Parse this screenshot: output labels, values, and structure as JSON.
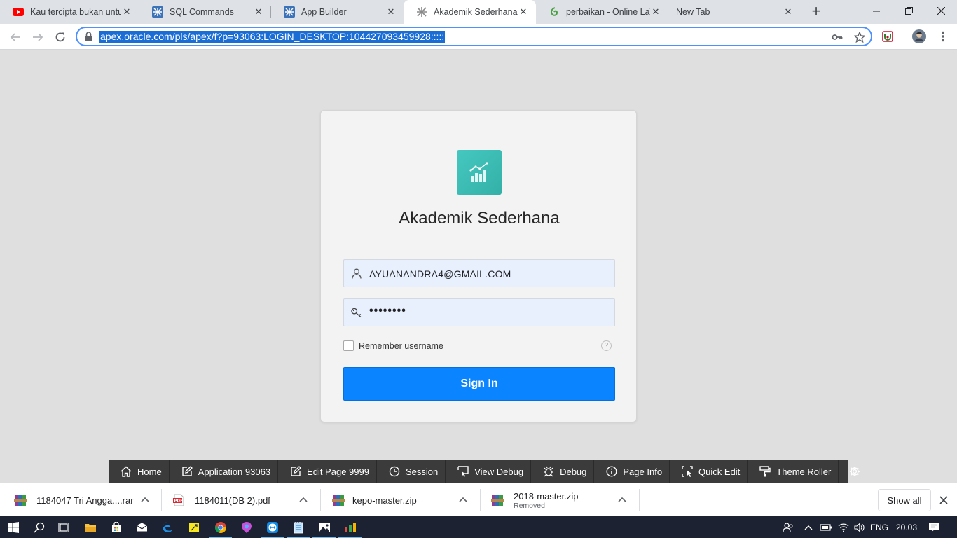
{
  "browser": {
    "tabs": [
      {
        "label": "Kau tercipta bukan untuk",
        "icon": "youtube-icon",
        "active": false
      },
      {
        "label": "SQL Commands",
        "icon": "apex-icon",
        "active": false
      },
      {
        "label": "App Builder",
        "icon": "apex-icon",
        "active": false
      },
      {
        "label": "Akademik Sederhana - ",
        "icon": "apex-icon",
        "active": true
      },
      {
        "label": "perbaikan - Online LaTeX",
        "icon": "overleaf-icon",
        "active": false
      },
      {
        "label": "New Tab",
        "icon": "",
        "active": false
      }
    ],
    "close_glyph": "✕",
    "new_tab_glyph": "+",
    "url": "apex.oracle.com/pls/apex/f?p=93063:LOGIN_DESKTOP:104427093459928:::::"
  },
  "login": {
    "app_title": "Akademik Sederhana",
    "username_value": "AYUANANDRA4@GMAIL.COM",
    "password_mask": "••••••••",
    "remember_label": "Remember username",
    "help_glyph": "?",
    "sign_in_label": "Sign In"
  },
  "dev_toolbar": {
    "items": [
      {
        "label": "Home",
        "icon": "home-icon"
      },
      {
        "label": "Application 93063",
        "icon": "edit-icon"
      },
      {
        "label": "Edit Page 9999",
        "icon": "pencil-icon"
      },
      {
        "label": "Session",
        "icon": "clock-icon"
      },
      {
        "label": "View Debug",
        "icon": "view-debug-icon"
      },
      {
        "label": "Debug",
        "icon": "bug-icon"
      },
      {
        "label": "Page Info",
        "icon": "info-icon"
      },
      {
        "label": "Quick Edit",
        "icon": "quick-edit-icon"
      },
      {
        "label": "Theme Roller",
        "icon": "paint-roller-icon"
      }
    ]
  },
  "downloads": {
    "items": [
      {
        "name": "1184047 Tri Angga....rar",
        "status": "",
        "icon": "rar-file-icon"
      },
      {
        "name": "1184011(DB 2).pdf",
        "status": "",
        "icon": "pdf-file-icon"
      },
      {
        "name": "kepo-master.zip",
        "status": "",
        "icon": "zip-file-icon"
      },
      {
        "name": "2018-master.zip",
        "status": "Removed",
        "icon": "zip-file-icon"
      }
    ],
    "show_all_label": "Show all"
  },
  "taskbar": {
    "language": "ENG",
    "time": "20.03"
  },
  "colors": {
    "accent_blue": "#0a84ff",
    "logo_teal": "#3dbdb5",
    "dev_toolbar_bg": "#3b3b3b",
    "taskbar_bg": "#1c2231"
  }
}
